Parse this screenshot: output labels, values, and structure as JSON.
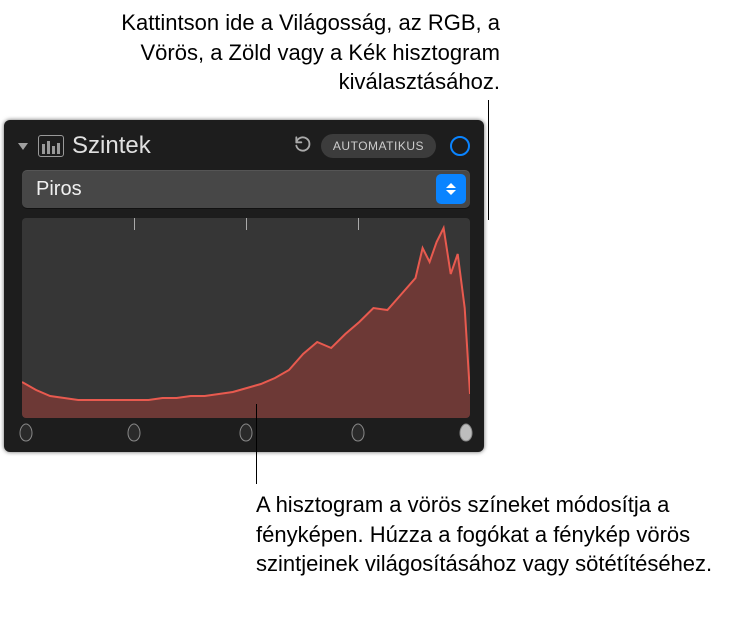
{
  "callouts": {
    "top": "Kattintson ide a Világosság, az RGB, a Vörös, a Zöld vagy a Kék hisztogram kiválasztásához.",
    "bottom": "A hisztogram a vörös színeket módosítja a fényképen. Húzza a fogókat a fénykép vörös szintjeinek világosításához vagy sötétítéséhez."
  },
  "panel": {
    "title": "Szintek",
    "auto_label": "AUTOMATIKUS",
    "channel_selected": "Piros"
  },
  "colors": {
    "accent": "#0a84ff",
    "histogram_stroke": "#e85a4f",
    "histogram_fill": "rgba(155,60,55,0.55)",
    "panel_bg": "#1d1d1d"
  },
  "chart_data": {
    "type": "area",
    "title": "Piros hisztogram",
    "xlabel": "",
    "ylabel": "",
    "xlim": [
      0,
      255
    ],
    "ylim": [
      0,
      100
    ],
    "x": [
      0,
      8,
      16,
      24,
      32,
      40,
      48,
      56,
      64,
      72,
      80,
      88,
      96,
      104,
      112,
      120,
      128,
      136,
      144,
      152,
      160,
      168,
      176,
      184,
      192,
      200,
      208,
      216,
      224,
      228,
      232,
      236,
      240,
      244,
      248,
      252,
      255
    ],
    "values": [
      18,
      14,
      11,
      10,
      9,
      9,
      9,
      9,
      9,
      9,
      10,
      10,
      11,
      11,
      12,
      13,
      15,
      17,
      20,
      24,
      32,
      38,
      35,
      42,
      48,
      55,
      54,
      62,
      70,
      85,
      78,
      88,
      95,
      72,
      82,
      55,
      12
    ]
  },
  "handles_pct": [
    1,
    25,
    50,
    75,
    99
  ]
}
